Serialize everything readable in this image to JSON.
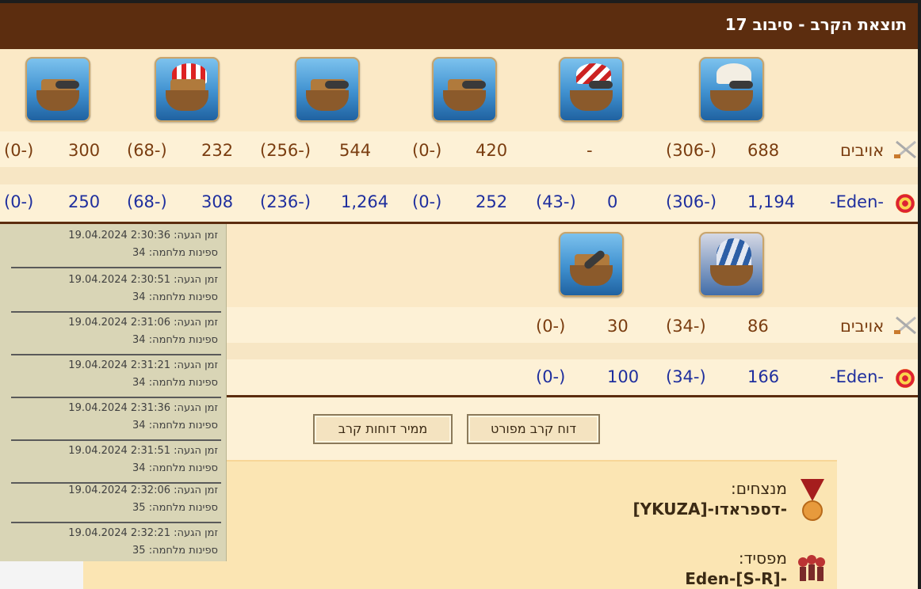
{
  "header": {
    "title": "תוצאת הקרב - סיבוב 17"
  },
  "top_table": {
    "enemies_label": "אויבים",
    "player_label": "-Eden-",
    "columns": [
      {
        "ship": "ship-6",
        "enemy": "688",
        "enemy_loss": "(306-)",
        "player": "1,194",
        "player_loss": "(306-)"
      },
      {
        "ship": "ship-5",
        "enemy": "-",
        "enemy_loss": "",
        "player": "0",
        "player_loss": "(43-)"
      },
      {
        "ship": "ship-4",
        "enemy": "420",
        "enemy_loss": "(0-)",
        "player": "252",
        "player_loss": "(0-)"
      },
      {
        "ship": "ship-3",
        "enemy": "544",
        "enemy_loss": "(256-)",
        "player": "1,264",
        "player_loss": "(236-)"
      },
      {
        "ship": "ship-2",
        "enemy": "232",
        "enemy_loss": "(68-)",
        "player": "308",
        "player_loss": "(68-)"
      },
      {
        "ship": "ship-1",
        "enemy": "300",
        "enemy_loss": "(0-)",
        "player": "250",
        "player_loss": "(0-)"
      }
    ]
  },
  "bottom_table": {
    "enemies_label": "אויבים",
    "player_label": "-Eden-",
    "columns": [
      {
        "ship": "ship-b2",
        "enemy": "86",
        "enemy_loss": "(34-)",
        "player": "166",
        "player_loss": "(34-)"
      },
      {
        "ship": "ship-b1",
        "enemy": "30",
        "enemy_loss": "(0-)",
        "player": "100",
        "player_loss": "(0-)"
      }
    ]
  },
  "sidebar": {
    "entries": [
      {
        "time": "זמן הגעה: 2:30:36 19.04.2024",
        "ships": "ספינות מלחמה: 34"
      },
      {
        "time": "זמן הגעה: 2:30:51 19.04.2024",
        "ships": "ספינות מלחמה: 34"
      },
      {
        "time": "זמן הגעה: 2:31:06 19.04.2024",
        "ships": "ספינות מלחמה: 34"
      },
      {
        "time": "זמן הגעה: 2:31:21 19.04.2024",
        "ships": "ספינות מלחמה: 34"
      },
      {
        "time": "זמן הגעה: 2:31:36 19.04.2024",
        "ships": "ספינות מלחמה: 34"
      },
      {
        "time": "זמן הגעה: 2:31:51 19.04.2024",
        "ships": "ספינות מלחמה: 34"
      },
      {
        "time": "זמן הגעה: 2:32:06 19.04.2024",
        "ships": "ספינות מלחמה: 35"
      },
      {
        "time": "זמן הגעה: 2:32:21 19.04.2024",
        "ships": "ספינות מלחמה: 35"
      }
    ]
  },
  "buttons": {
    "detailed_report": "דוח קרב מפורט",
    "report_sorter": "ממיר דוחות קרב"
  },
  "result": {
    "winners_label": "מנצחים:",
    "winners_value": "-דספראדו-[YKUZA]",
    "loser_label": "מפסיד:",
    "loser_value": "-Eden-[S-R]"
  },
  "icons": {
    "enemies": "crossed-swords-icon",
    "player": "target-icon",
    "winners": "medal-icon",
    "loser": "pirates-icon"
  },
  "colors": {
    "header_bg": "#5c2d0f",
    "enemy_text": "#7a3d10",
    "player_text": "#1f2f9e",
    "page_bg": "#fdf1d6"
  }
}
